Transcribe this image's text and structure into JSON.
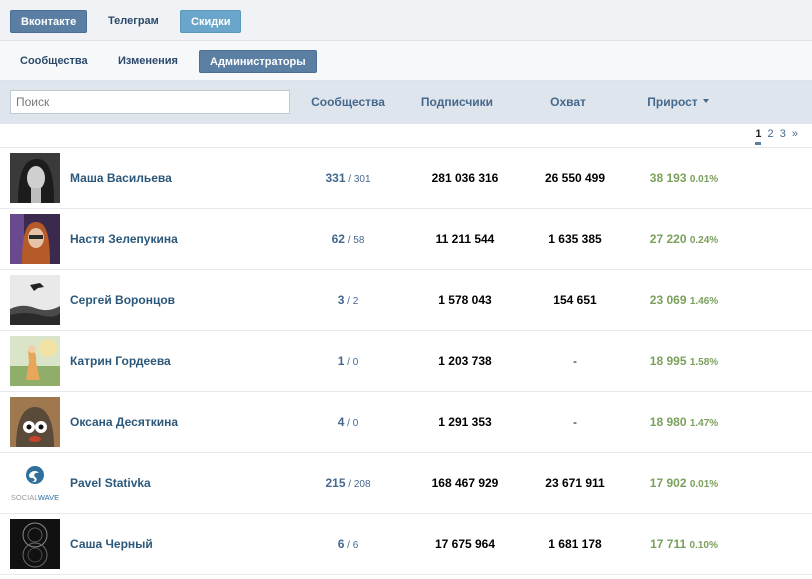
{
  "top_tabs": [
    "Вконтакте",
    "Телеграм",
    "Скидки"
  ],
  "sub_tabs": [
    "Сообщества",
    "Изменения",
    "Администраторы"
  ],
  "search": {
    "placeholder": "Поиск"
  },
  "columns": {
    "communities": "Сообщества",
    "subscribers": "Подписчики",
    "reach": "Охват",
    "growth": "Прирост"
  },
  "pagination": {
    "pages": [
      "1",
      "2",
      "3"
    ],
    "next": "»",
    "current": 1
  },
  "rows": [
    {
      "name": "Маша Васильева",
      "communities": "331",
      "communities_sub": " / 301",
      "subscribers": "281 036 316",
      "reach": "26 550 499",
      "growth": "38 193",
      "growth_pct": "0.01%"
    },
    {
      "name": "Настя Зелепукина",
      "communities": "62",
      "communities_sub": " / 58",
      "subscribers": "11 211 544",
      "reach": "1 635 385",
      "growth": "27 220",
      "growth_pct": "0.24%"
    },
    {
      "name": "Сергей Воронцов",
      "communities": "3",
      "communities_sub": " / 2",
      "subscribers": "1 578 043",
      "reach": "154 651",
      "growth": "23 069",
      "growth_pct": "1.46%"
    },
    {
      "name": "Катрин Гордеева",
      "communities": "1",
      "communities_sub": " / 0",
      "subscribers": "1 203 738",
      "reach": "-",
      "growth": "18 995",
      "growth_pct": "1.58%"
    },
    {
      "name": "Оксана Десяткина",
      "communities": "4",
      "communities_sub": " / 0",
      "subscribers": "1 291 353",
      "reach": "-",
      "growth": "18 980",
      "growth_pct": "1.47%"
    },
    {
      "name": "Pavel Stativka",
      "communities": "215",
      "communities_sub": " / 208",
      "subscribers": "168 467 929",
      "reach": "23 671 911",
      "growth": "17 902",
      "growth_pct": "0.01%"
    },
    {
      "name": "Саша Черный",
      "communities": "6",
      "communities_sub": " / 6",
      "subscribers": "17 675 964",
      "reach": "1 681 178",
      "growth": "17 711",
      "growth_pct": "0.10%"
    }
  ],
  "avatar_logo_text": {
    "social": "SOCIAL",
    "wave": "WAVE"
  },
  "colors": {
    "accent": "#5b7ea3",
    "link": "#2b587a",
    "growth": "#7aa05b",
    "header_bg": "#dfe5ec"
  }
}
